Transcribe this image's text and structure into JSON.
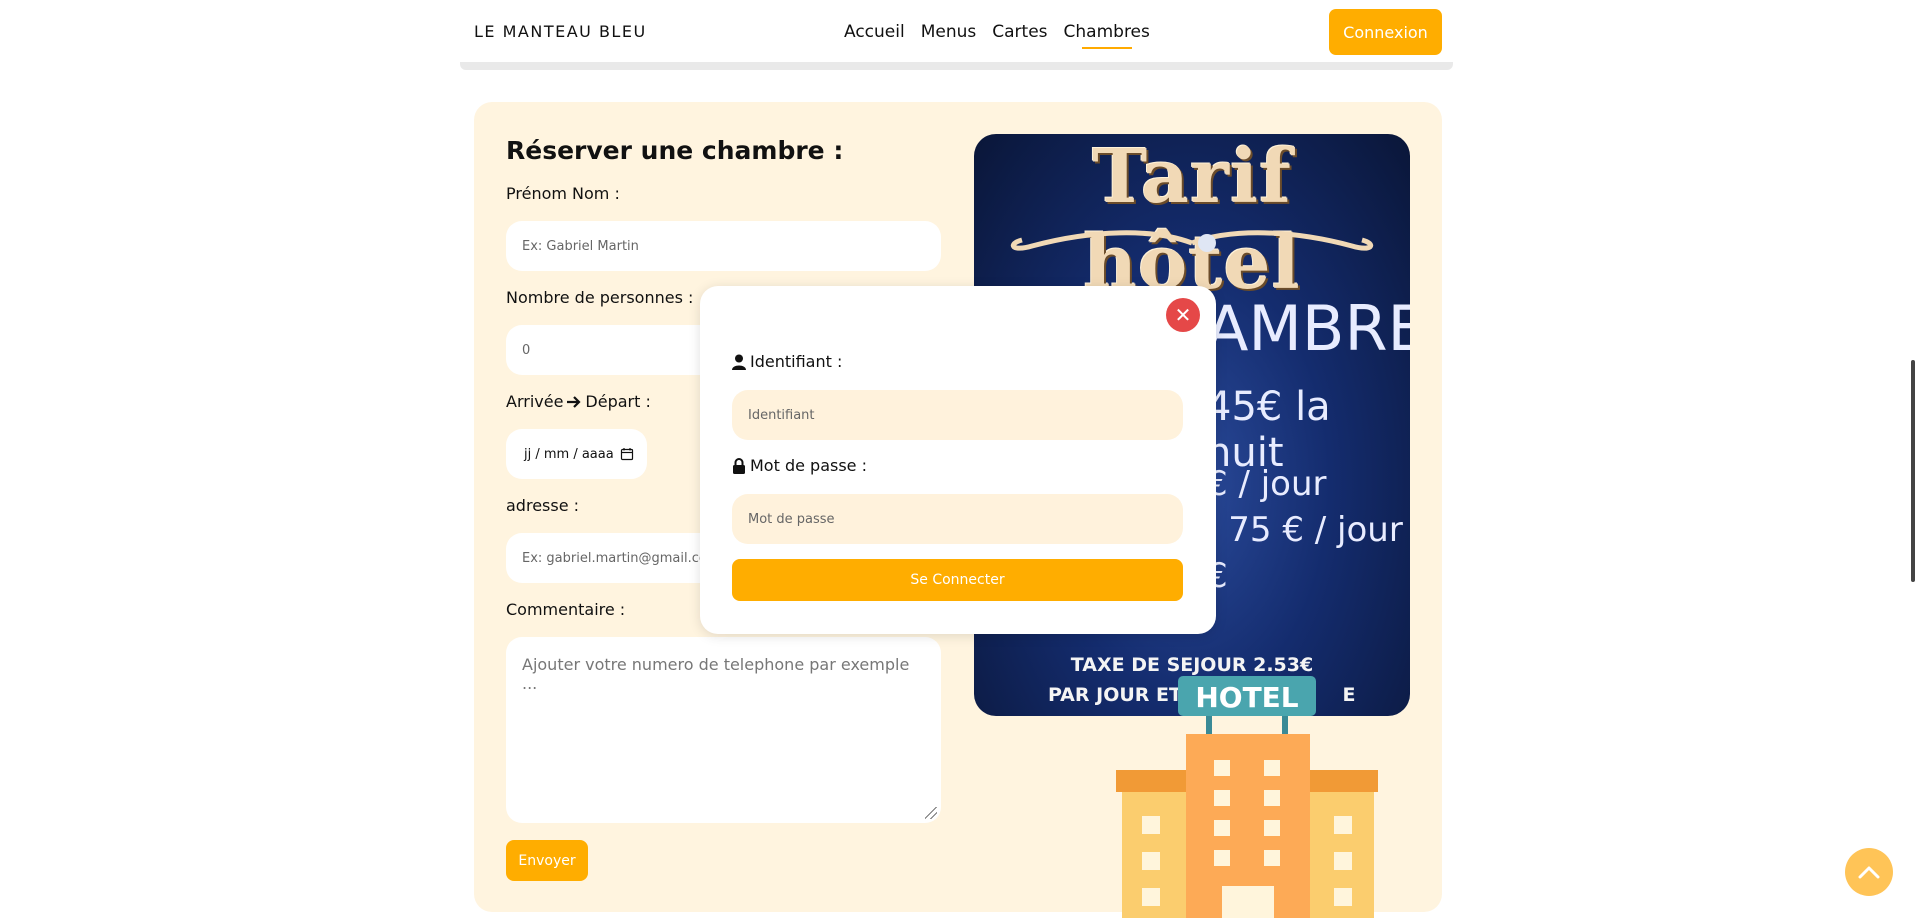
{
  "header": {
    "brand": "LE MANTEAU BLEU",
    "nav": [
      {
        "label": "Accueil",
        "active": false
      },
      {
        "label": "Menus",
        "active": false
      },
      {
        "label": "Cartes",
        "active": false
      },
      {
        "label": "Chambres",
        "active": true
      }
    ],
    "login_label": "Connexion"
  },
  "form": {
    "title": "Réserver une chambre :",
    "name_label": "Prénom Nom :",
    "name_placeholder": "Ex: Gabriel  Martin",
    "people_label": "Nombre de personnes :",
    "people_value": "0",
    "dates_label_start": "Arrivée",
    "dates_label_end": "Départ :",
    "date_placeholder": "jj / mm / aaaa",
    "address_label": "adresse :",
    "address_placeholder": "Ex: gabriel.martin@gmail.com",
    "comment_label": "Commentaire :",
    "comment_placeholder": "Ajouter votre numero de telephone par exemple  ...",
    "submit_label": "Envoyer"
  },
  "poster": {
    "title": "Tarif hôtel",
    "line1": "AMBRE",
    "line2": "45€ la nuit",
    "line3": "€  /  jour",
    "line4": ":  75  €  /  jour",
    "line5": "€",
    "tax1": "TAXE DE SEJOUR 2.53€",
    "tax2": "PAR JOUR ET P",
    "tax2_end": "E",
    "sign": "HOTEL"
  },
  "modal": {
    "username_label": "Identifiant :",
    "username_placeholder": "Identifiant",
    "password_label": "Mot de passe :",
    "password_placeholder": "Mot de passe",
    "submit_label": "Se Connecter"
  },
  "colors": {
    "accent": "#ffad00",
    "panel_bg": "#fff4df",
    "close": "#e54848"
  }
}
